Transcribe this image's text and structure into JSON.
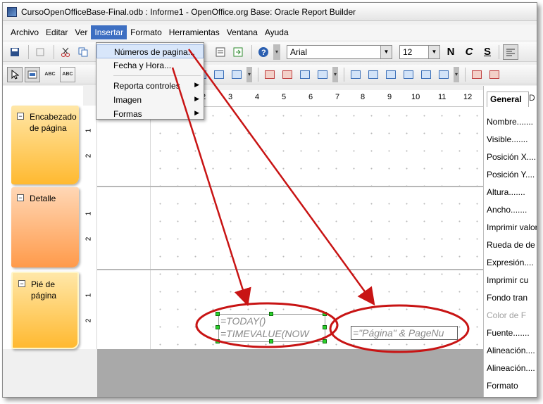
{
  "window": {
    "title": "CursoOpenOfficeBase-Final.odb : Informe1 - OpenOffice.org Base: Oracle Report Builder"
  },
  "menubar": {
    "items": [
      "Archivo",
      "Editar",
      "Ver",
      "Insertar",
      "Formato",
      "Herramientas",
      "Ventana",
      "Ayuda"
    ],
    "active_index": 3
  },
  "insert_menu": {
    "items": [
      {
        "label": "Números de pagina...",
        "submenu": false
      },
      {
        "label": "Fecha y Hora...",
        "submenu": false
      },
      {
        "label": "Reporta controles",
        "submenu": true
      },
      {
        "label": "Imagen",
        "submenu": true
      },
      {
        "label": "Formas",
        "submenu": true
      }
    ],
    "highlighted_index": 0
  },
  "toolbar": {
    "font_name": "Arial",
    "font_size": "12",
    "bold": "N",
    "italic": "C",
    "underline": "S",
    "abc1": "ABC",
    "abc2": "ABC"
  },
  "ruler": {
    "marks": [
      "2",
      "3",
      "4",
      "5",
      "6",
      "7",
      "8",
      "9",
      "10",
      "11",
      "12"
    ]
  },
  "sections": [
    {
      "label": "Encabezado de página",
      "selected": false
    },
    {
      "label": "Detalle",
      "selected": false
    },
    {
      "label": "Pié de página",
      "selected": true
    }
  ],
  "vruler_marks": [
    "1",
    "2",
    "1",
    "2",
    "1",
    "2"
  ],
  "fields": {
    "date_line1": "=TODAY()",
    "date_line2": "=TIMEVALUE(NOW",
    "page": "=\"Página\" & PageNu"
  },
  "properties": {
    "tab_general": "General",
    "tab_data": "D",
    "items": [
      {
        "label": "Nombre.......",
        "disabled": false
      },
      {
        "label": "Visible.......",
        "disabled": false
      },
      {
        "label": "Posición X....",
        "disabled": false
      },
      {
        "label": "Posición Y....",
        "disabled": false
      },
      {
        "label": "Altura.......",
        "disabled": false
      },
      {
        "label": "Ancho.......",
        "disabled": false
      },
      {
        "label": "Imprimir valor",
        "disabled": false
      },
      {
        "label": "Rueda de de",
        "disabled": false
      },
      {
        "label": "Expresión....",
        "disabled": false
      },
      {
        "label": "Imprimir cu",
        "disabled": false
      },
      {
        "label": "Fondo tran",
        "disabled": false
      },
      {
        "label": "Color de F",
        "disabled": true
      },
      {
        "label": "Fuente.......",
        "disabled": false
      },
      {
        "label": "Alineación....",
        "disabled": false
      },
      {
        "label": "Alineación....",
        "disabled": false
      },
      {
        "label": "Formato",
        "disabled": false
      }
    ]
  },
  "colors": {
    "menu_active": "#3d6fc2",
    "section_orange": "#ffb930",
    "section_detail": "#ff9a4a",
    "annotation_red": "#c81414",
    "selection_handle": "#2bd12b"
  }
}
